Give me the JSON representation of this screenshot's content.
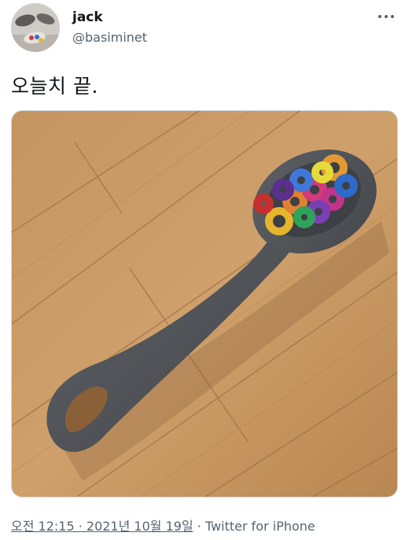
{
  "tweet": {
    "author": {
      "name": "jack",
      "handle": "@basiminet"
    },
    "text": "오늘치 끝.",
    "timestamp": "오전 12:15 · 2021년 10월 19일",
    "separator": "·",
    "source": "Twitter for iPhone"
  },
  "colors": {
    "text_primary": "#0f1419",
    "text_secondary": "#536471",
    "floor": "#c89a63",
    "foam": "#4d5055"
  }
}
